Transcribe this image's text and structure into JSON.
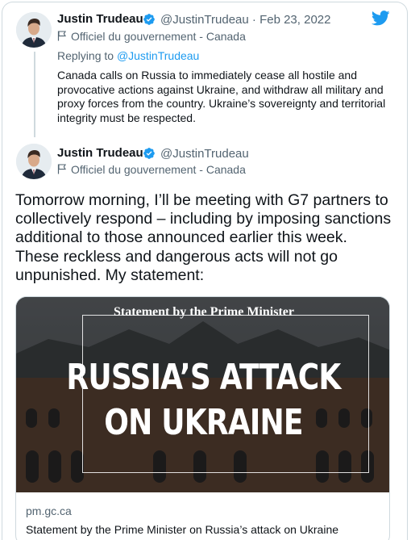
{
  "reply_tweet": {
    "author_name": "Justin Trudeau",
    "handle": "@JustinTrudeau",
    "separator": "·",
    "date": "Feb 23, 2022",
    "gov_label": "Officiel du gouvernement - Canada",
    "replying_prefix": "Replying to",
    "replying_handle": "@JustinTrudeau",
    "text": "Canada calls on Russia to immediately cease all hostile and provocative actions against Ukraine, and withdraw all military and proxy forces from the country. Ukraine’s sovereignty and territorial integrity must be respected."
  },
  "main_tweet": {
    "author_name": "Justin Trudeau",
    "handle": "@JustinTrudeau",
    "gov_label": "Officiel du gouvernement - Canada",
    "text": "Tomorrow morning, I’ll be meeting with G7 partners to collectively respond – including by imposing sanctions additional to those announced earlier this week. These reckless and dangerous acts will not go unpunished. My statement:"
  },
  "link_card": {
    "image_heading": "Statement by the Prime Minister",
    "headline_line1": "RUSSIA’S ATTACK",
    "headline_line2": "ON UKRAINE",
    "domain": "pm.gc.ca",
    "title": "Statement by the Prime Minister on Russia’s attack on Ukraine"
  },
  "icons": {
    "brand": "twitter-bird-icon",
    "verified": "verified-badge-icon",
    "gov": "government-flag-icon"
  },
  "colors": {
    "accent": "#1d9bf0",
    "secondary_text": "#536471",
    "border": "#cfd9de"
  }
}
